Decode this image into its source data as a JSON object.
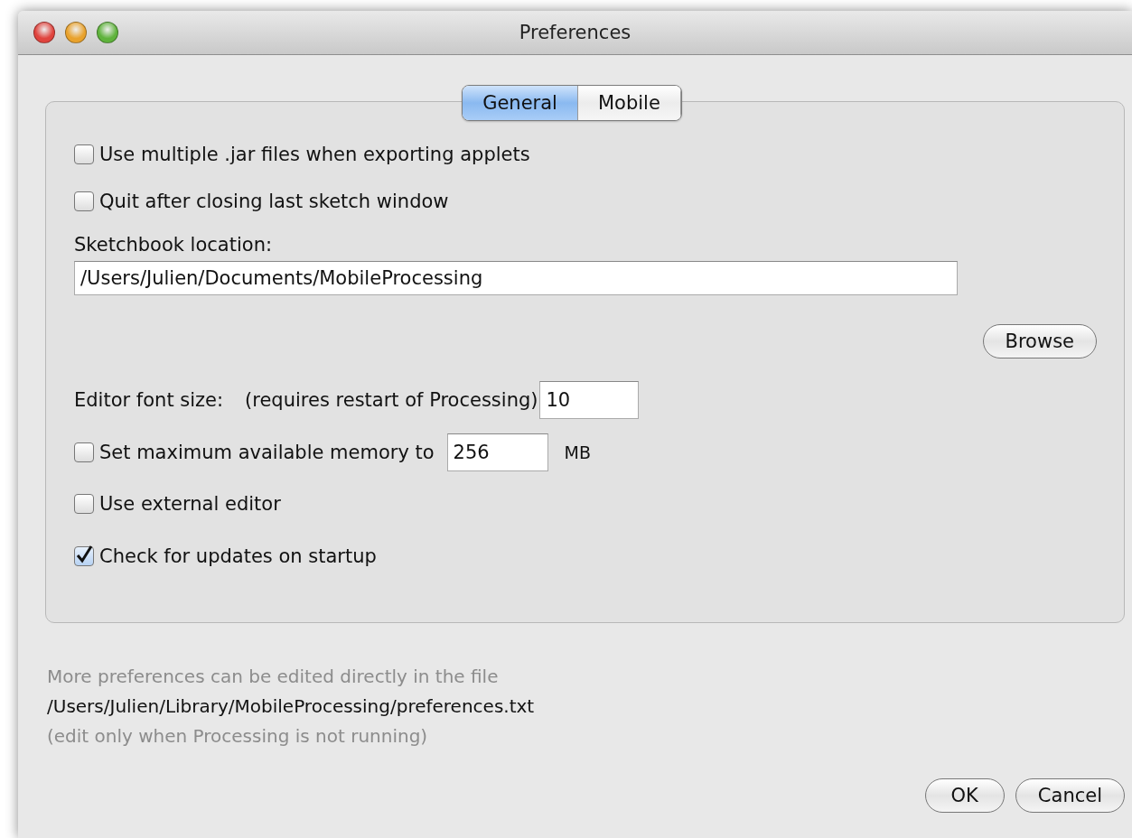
{
  "window": {
    "title": "Preferences"
  },
  "tabs": [
    {
      "label": "General",
      "selected": true
    },
    {
      "label": "Mobile",
      "selected": false
    }
  ],
  "options_top": [
    {
      "label": "Use multiple .jar files when exporting applets",
      "checked": false
    },
    {
      "label": "Quit after closing last sketch window",
      "checked": false
    }
  ],
  "sketchbook": {
    "label": "Sketchbook location:",
    "value": "/Users/Julien/Documents/MobileProcessing",
    "browse": "Browse"
  },
  "font_size": {
    "label": "Editor font size:",
    "note": "(requires restart of Processing)",
    "value": "10"
  },
  "memory": {
    "label": "Set maximum available memory to",
    "checked": false,
    "value": "256",
    "unit": "MB"
  },
  "options_bottom": [
    {
      "label": "Use external editor",
      "checked": false
    },
    {
      "label": "Check for updates on startup",
      "checked": true
    }
  ],
  "footer": [
    "More preferences can be edited directly in the file",
    "/Users/Julien/Library/MobileProcessing/preferences.txt",
    "(edit only when Processing is not running)"
  ],
  "buttons": [
    "OK",
    "Cancel"
  ]
}
